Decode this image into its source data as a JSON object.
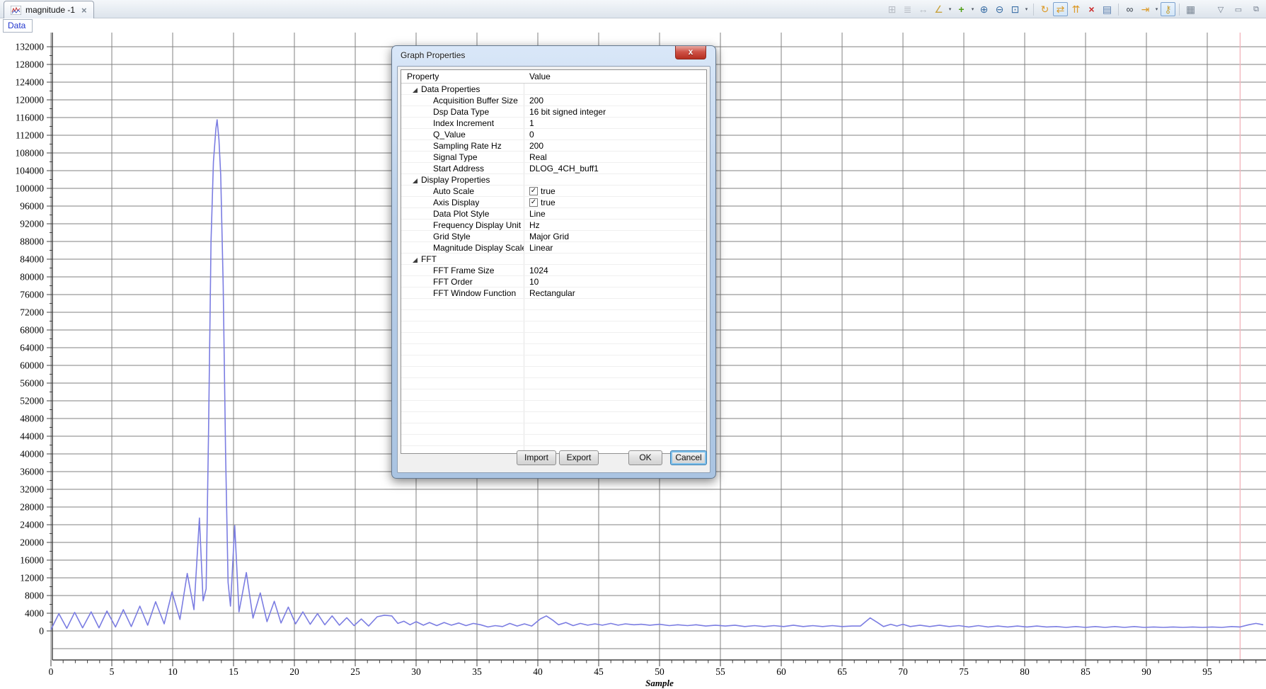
{
  "tab": {
    "title": "magnitude -1",
    "close_glyph": "×"
  },
  "panel": {
    "data_label": "Data"
  },
  "window_controls": [
    {
      "name": "view-menu-chevron-icon",
      "glyph": "▽"
    },
    {
      "name": "minimize-icon",
      "glyph": "▭"
    },
    {
      "name": "restore-icon",
      "glyph": "⧉"
    }
  ],
  "toolbar": {
    "items": [
      {
        "name": "reset-view-icon",
        "glyph": "⊞",
        "color": "#b7bcc4",
        "disabled": true
      },
      {
        "name": "align-center-icon",
        "glyph": "≣",
        "color": "#b7bcc4",
        "disabled": true
      },
      {
        "name": "fit-width-icon",
        "glyph": "↔",
        "color": "#b7bcc4",
        "disabled": true
      },
      {
        "name": "measure-icon",
        "glyph": "∠",
        "color": "#c8a23c",
        "dropdown": true
      },
      {
        "name": "add-graph-icon",
        "glyph": "+",
        "color": "#4f9e14",
        "dropdown": true,
        "bold": true
      },
      {
        "name": "zoom-in-icon",
        "glyph": "⊕",
        "color": "#3a6ea5"
      },
      {
        "name": "zoom-out-icon",
        "glyph": "⊖",
        "color": "#3a6ea5"
      },
      {
        "name": "zoom-region-icon",
        "glyph": "⊡",
        "color": "#3a6ea5",
        "dropdown": true
      },
      {
        "sep": true
      },
      {
        "name": "refresh-icon",
        "glyph": "↻",
        "color": "#dc9a28"
      },
      {
        "name": "swap-axes-icon",
        "glyph": "⇄",
        "color": "#dc9a28",
        "toggled": true
      },
      {
        "name": "continuous-refresh-icon",
        "glyph": "⇈",
        "color": "#dc9a28"
      },
      {
        "name": "remove-graph-icon",
        "glyph": "×",
        "color": "#cc2b2b",
        "bold": true
      },
      {
        "name": "graph-properties-icon",
        "glyph": "▤",
        "color": "#5b7fae"
      },
      {
        "sep": true
      },
      {
        "name": "watch-data-icon",
        "glyph": "∞",
        "color": "#3c444e"
      },
      {
        "name": "step-forward-icon",
        "glyph": "⇥",
        "color": "#dc9a28",
        "dropdown": true
      },
      {
        "name": "lock-scale-icon",
        "glyph": "⚷",
        "color": "#c8a23c",
        "toggled": true
      },
      {
        "sep": true
      },
      {
        "name": "view-list-icon",
        "glyph": "▦",
        "color": "#7a8694"
      }
    ]
  },
  "dialog": {
    "title": "Graph Properties",
    "close_glyph": "x",
    "columns": {
      "property": "Property",
      "value": "Value"
    },
    "rows": [
      {
        "type": "group",
        "label": "Data Properties"
      },
      {
        "type": "item",
        "label": "Acquisition Buffer Size",
        "value": "200"
      },
      {
        "type": "item",
        "label": "Dsp Data Type",
        "value": "16 bit signed integer"
      },
      {
        "type": "item",
        "label": "Index Increment",
        "value": "1"
      },
      {
        "type": "item",
        "label": "Q_Value",
        "value": "0"
      },
      {
        "type": "item",
        "label": "Sampling Rate Hz",
        "value": "200"
      },
      {
        "type": "item",
        "label": "Signal Type",
        "value": "Real"
      },
      {
        "type": "item",
        "label": "Start Address",
        "value": "DLOG_4CH_buff1"
      },
      {
        "type": "group",
        "label": "Display Properties"
      },
      {
        "type": "item",
        "label": "Auto Scale",
        "value": "true",
        "checkbox": true,
        "checked": true
      },
      {
        "type": "item",
        "label": "Axis Display",
        "value": "true",
        "checkbox": true,
        "checked": true
      },
      {
        "type": "item",
        "label": "Data Plot Style",
        "value": "Line"
      },
      {
        "type": "item",
        "label": "Frequency Display Unit",
        "value": "Hz"
      },
      {
        "type": "item",
        "label": "Grid Style",
        "value": "Major Grid"
      },
      {
        "type": "item",
        "label": "Magnitude Display Scale",
        "value": "Linear"
      },
      {
        "type": "group",
        "label": "FFT"
      },
      {
        "type": "item",
        "label": "FFT Frame Size",
        "value": "1024"
      },
      {
        "type": "item",
        "label": "FFT Order",
        "value": "10"
      },
      {
        "type": "item",
        "label": "FFT Window Function",
        "value": "Rectangular"
      }
    ],
    "buttons": [
      {
        "name": "import-button",
        "label": "Import"
      },
      {
        "name": "export-button",
        "label": "Export"
      },
      {
        "name": "ok-button",
        "label": "OK"
      },
      {
        "name": "cancel-button",
        "label": "Cancel",
        "focused": true
      }
    ]
  },
  "chart_data": {
    "type": "line",
    "title": "magnitude -1",
    "xlabel": "Sample",
    "ylabel": "",
    "grid": "major",
    "line_color": "#7b7de2",
    "grid_color": "#808080",
    "cursor_color": "#f2b6bd",
    "cursor_x": 97.7,
    "x_ticks": {
      "from": 0,
      "to": 95,
      "step": 5,
      "minor_step": 1
    },
    "y_ticks": {
      "from": 0,
      "to": 132000,
      "step": 4000,
      "minor_step": 2000
    },
    "xlim": [
      0,
      100
    ],
    "ylim": [
      -6600,
      135000
    ],
    "series": [
      {
        "name": "magnitude",
        "points": [
          [
            0,
            300
          ],
          [
            0.65,
            3900
          ],
          [
            1.3,
            600
          ],
          [
            1.95,
            4200
          ],
          [
            2.6,
            700
          ],
          [
            3.3,
            4300
          ],
          [
            3.95,
            700
          ],
          [
            4.6,
            4500
          ],
          [
            5.3,
            900
          ],
          [
            5.95,
            4800
          ],
          [
            6.6,
            1000
          ],
          [
            7.3,
            5600
          ],
          [
            7.95,
            1300
          ],
          [
            8.6,
            6600
          ],
          [
            9.3,
            1600
          ],
          [
            9.95,
            8800
          ],
          [
            10.6,
            2600
          ],
          [
            11.2,
            13000
          ],
          [
            11.75,
            4800
          ],
          [
            12.2,
            25500
          ],
          [
            12.5,
            6800
          ],
          [
            12.75,
            9500
          ],
          [
            12.95,
            45000
          ],
          [
            13.15,
            88000
          ],
          [
            13.35,
            106000
          ],
          [
            13.55,
            113500
          ],
          [
            13.65,
            115500
          ],
          [
            13.8,
            111000
          ],
          [
            13.95,
            103000
          ],
          [
            14.15,
            78000
          ],
          [
            14.35,
            40000
          ],
          [
            14.55,
            11000
          ],
          [
            14.75,
            5600
          ],
          [
            15.1,
            23800
          ],
          [
            15.45,
            4300
          ],
          [
            16.05,
            13200
          ],
          [
            16.6,
            2900
          ],
          [
            17.2,
            8600
          ],
          [
            17.75,
            2100
          ],
          [
            18.35,
            6700
          ],
          [
            18.9,
            1800
          ],
          [
            19.5,
            5400
          ],
          [
            20.1,
            1600
          ],
          [
            20.7,
            4300
          ],
          [
            21.3,
            1500
          ],
          [
            21.9,
            3900
          ],
          [
            22.5,
            1400
          ],
          [
            23.1,
            3400
          ],
          [
            23.7,
            1300
          ],
          [
            24.3,
            3000
          ],
          [
            24.9,
            1200
          ],
          [
            25.5,
            2700
          ],
          [
            26.1,
            1100
          ],
          [
            26.8,
            3200
          ],
          [
            27.4,
            3550
          ],
          [
            28,
            3400
          ],
          [
            28.5,
            1700
          ],
          [
            29,
            2200
          ],
          [
            29.5,
            1400
          ],
          [
            30,
            2100
          ],
          [
            30.6,
            1300
          ],
          [
            31.1,
            1900
          ],
          [
            31.7,
            1200
          ],
          [
            32.3,
            1900
          ],
          [
            32.9,
            1300
          ],
          [
            33.5,
            1800
          ],
          [
            34.1,
            1200
          ],
          [
            34.7,
            1700
          ],
          [
            35.3,
            1400
          ],
          [
            35.9,
            900
          ],
          [
            36.5,
            1200
          ],
          [
            37.1,
            1000
          ],
          [
            37.7,
            1700
          ],
          [
            38.3,
            1100
          ],
          [
            38.9,
            1600
          ],
          [
            39.5,
            1100
          ],
          [
            40.2,
            2700
          ],
          [
            40.7,
            3400
          ],
          [
            41.2,
            2500
          ],
          [
            41.7,
            1400
          ],
          [
            42.3,
            1900
          ],
          [
            42.9,
            1200
          ],
          [
            43.5,
            1700
          ],
          [
            44.1,
            1300
          ],
          [
            44.7,
            1600
          ],
          [
            45.3,
            1300
          ],
          [
            46,
            1700
          ],
          [
            46.6,
            1300
          ],
          [
            47.2,
            1600
          ],
          [
            47.9,
            1400
          ],
          [
            48.5,
            1500
          ],
          [
            49.2,
            1300
          ],
          [
            50,
            1500
          ],
          [
            50.8,
            1200
          ],
          [
            51.5,
            1400
          ],
          [
            52.3,
            1200
          ],
          [
            53,
            1400
          ],
          [
            53.8,
            1100
          ],
          [
            54.6,
            1300
          ],
          [
            55.4,
            1100
          ],
          [
            56.2,
            1300
          ],
          [
            57,
            1000
          ],
          [
            57.8,
            1200
          ],
          [
            58.6,
            1000
          ],
          [
            59.4,
            1200
          ],
          [
            60.2,
            1000
          ],
          [
            61,
            1300
          ],
          [
            61.8,
            1000
          ],
          [
            62.6,
            1200
          ],
          [
            63.4,
            1000
          ],
          [
            64.2,
            1200
          ],
          [
            65,
            1000
          ],
          [
            65.8,
            1100
          ],
          [
            66.5,
            1100
          ],
          [
            67.3,
            2950
          ],
          [
            67.9,
            1900
          ],
          [
            68.4,
            1000
          ],
          [
            69,
            1500
          ],
          [
            69.5,
            1100
          ],
          [
            70,
            1500
          ],
          [
            70.6,
            1000
          ],
          [
            71.4,
            1300
          ],
          [
            72.2,
            1000
          ],
          [
            73,
            1300
          ],
          [
            73.8,
            1000
          ],
          [
            74.6,
            1200
          ],
          [
            75.4,
            900
          ],
          [
            76.2,
            1200
          ],
          [
            77,
            900
          ],
          [
            77.8,
            1100
          ],
          [
            78.6,
            900
          ],
          [
            79.4,
            1100
          ],
          [
            80.2,
            900
          ],
          [
            81,
            1100
          ],
          [
            81.8,
            900
          ],
          [
            82.6,
            1000
          ],
          [
            83.4,
            800
          ],
          [
            84.2,
            1000
          ],
          [
            85,
            800
          ],
          [
            85.8,
            1000
          ],
          [
            86.6,
            800
          ],
          [
            87.4,
            1000
          ],
          [
            88.2,
            800
          ],
          [
            89,
            1000
          ],
          [
            89.8,
            800
          ],
          [
            90.6,
            900
          ],
          [
            91.4,
            800
          ],
          [
            92.2,
            900
          ],
          [
            93,
            800
          ],
          [
            93.8,
            900
          ],
          [
            94.6,
            800
          ],
          [
            95.4,
            900
          ],
          [
            96.2,
            800
          ],
          [
            97,
            1000
          ],
          [
            97.7,
            900
          ],
          [
            98.4,
            1400
          ],
          [
            99,
            1700
          ],
          [
            99.6,
            1400
          ]
        ]
      }
    ]
  }
}
